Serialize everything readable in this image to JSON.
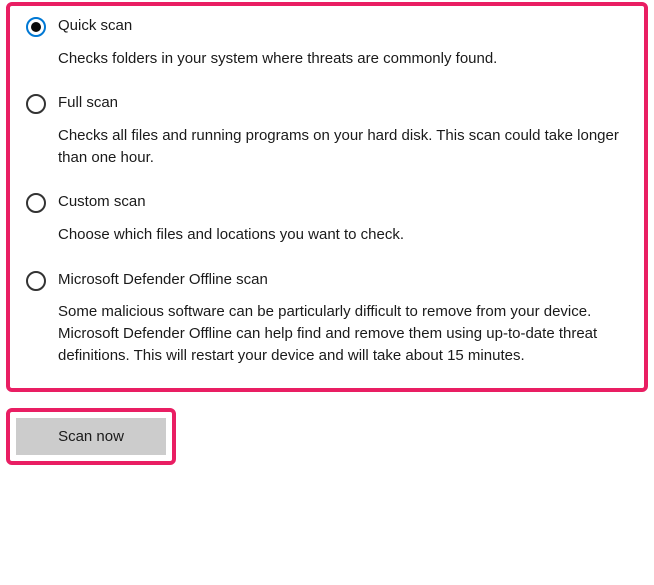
{
  "scanOptions": {
    "options": [
      {
        "id": "quick",
        "title": "Quick scan",
        "description": "Checks folders in your system where threats are commonly found.",
        "selected": true
      },
      {
        "id": "full",
        "title": "Full scan",
        "description": "Checks all files and running programs on your hard disk. This scan could take longer than one hour.",
        "selected": false
      },
      {
        "id": "custom",
        "title": "Custom scan",
        "description": "Choose which files and locations you want to check.",
        "selected": false
      },
      {
        "id": "offline",
        "title": "Microsoft Defender Offline scan",
        "description": "Some malicious software can be particularly difficult to remove from your device. Microsoft Defender Offline can help find and remove them using up-to-date threat definitions. This will restart your device and will take about 15 minutes.",
        "selected": false
      }
    ]
  },
  "actions": {
    "scanNowLabel": "Scan now"
  },
  "annotationColor": "#e91e63"
}
